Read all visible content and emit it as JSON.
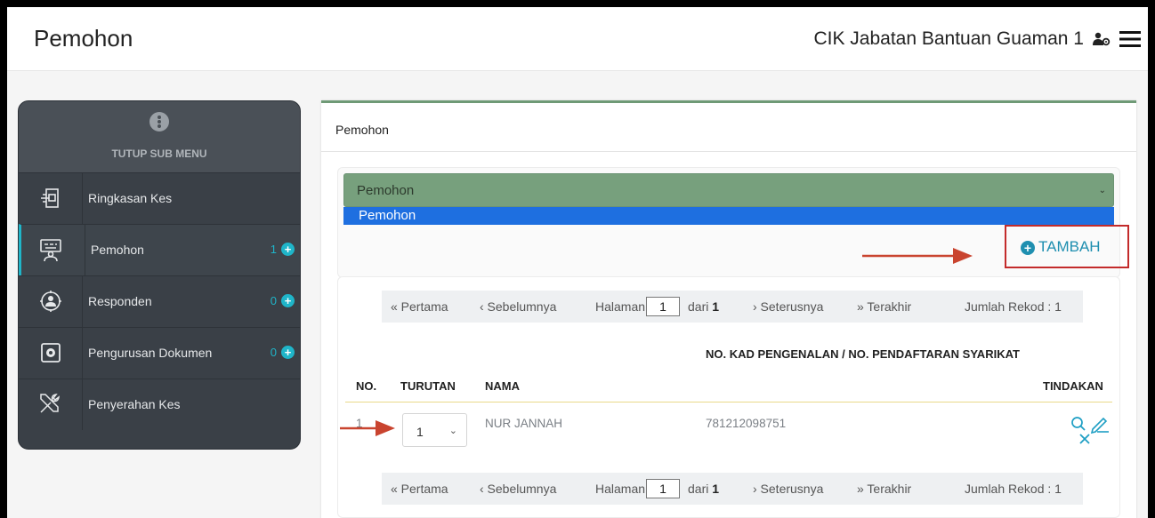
{
  "header": {
    "title": "Pemohon",
    "user": "CIK Jabatan Bantuan Guaman 1"
  },
  "sidebar": {
    "toggle_label": "TUTUP SUB MENU",
    "items": [
      {
        "label": "Ringkasan Kes",
        "count": "",
        "icon": "case-summary-icon"
      },
      {
        "label": "Pemohon",
        "count": "1",
        "icon": "applicant-icon",
        "active": true
      },
      {
        "label": "Responden",
        "count": "0",
        "icon": "respondent-icon"
      },
      {
        "label": "Pengurusan Dokumen",
        "count": "0",
        "icon": "document-settings-icon"
      },
      {
        "label": "Penyerahan Kes",
        "count": "",
        "icon": "tools-icon"
      }
    ]
  },
  "card": {
    "title": "Pemohon",
    "select_value": "Pemohon",
    "select_option": "Pemohon",
    "add_button": "TAMBAH"
  },
  "pager": {
    "first": "« Pertama",
    "prev": "‹ Sebelumnya",
    "page_label": "Halaman",
    "page": "1",
    "of": "dari",
    "total_pages": "1",
    "next": "› Seterusnya",
    "last": "» Terakhir",
    "records": "Jumlah Rekod : 1"
  },
  "table": {
    "columns": {
      "no": "NO.",
      "turutan": "TURUTAN",
      "nama": "NAMA",
      "idno": "NO. KAD PENGENALAN / NO. PENDAFTARAN SYARIKAT",
      "tindakan": "TINDAKAN"
    },
    "rows": [
      {
        "no": "1",
        "turutan": "1",
        "nama": "NUR JANNAH",
        "idno": "781212098751"
      }
    ]
  },
  "colors": {
    "accent": "#1fb5c9",
    "select_green": "#77a07d",
    "annotation_red": "#c32b2b"
  }
}
